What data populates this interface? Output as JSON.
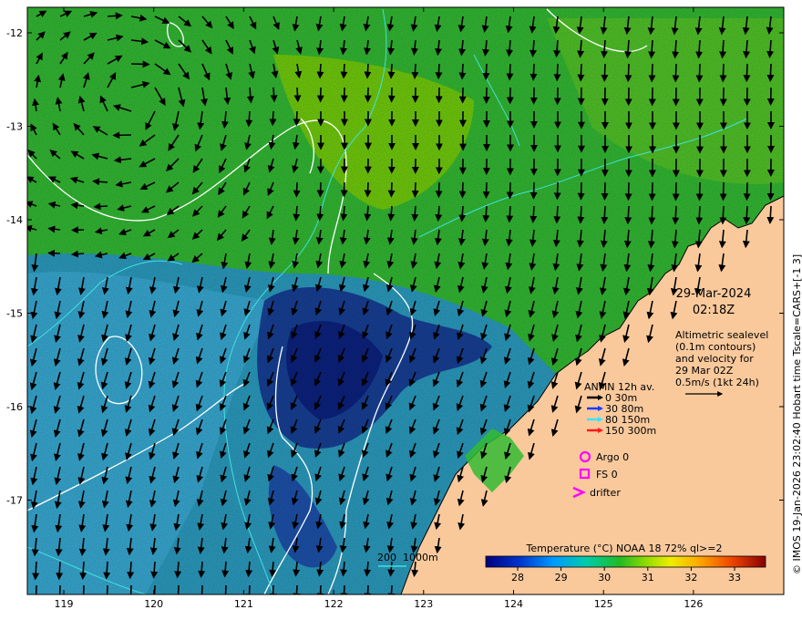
{
  "map": {
    "date": "29-Mar-2024",
    "time": "02:18Z",
    "side_credit": "© IMOS 19-Jan-2026 23:02:40 Hobart time Tscale=CARS+[-1 3]",
    "sealevel_note": [
      "Altimetric sealevel",
      "(0.1m contours)",
      "and velocity for",
      "29 Mar 02Z",
      "0.5m/s (1kt 24h)"
    ],
    "lon_ticks": [
      "119",
      "120",
      "121",
      "122",
      "123",
      "124",
      "125",
      "126"
    ],
    "lat_ticks": [
      "-12",
      "-13",
      "-14",
      "-15",
      "-16",
      "-17"
    ],
    "anmn": {
      "title": "ANMN 12h av.",
      "items": [
        {
          "label": "0 30m",
          "color": "#000000"
        },
        {
          "label": "30 80m",
          "color": "#1a3cff"
        },
        {
          "label": "80 150m",
          "color": "#40e0ff"
        },
        {
          "label": "150 300m",
          "color": "#ff1a1a"
        }
      ]
    },
    "markers": {
      "argo": "Argo 0",
      "fs": "FS 0",
      "drifter": "drifter",
      "color": "#ff00ff"
    },
    "depth_legend": {
      "label1": "200",
      "label2": "1000m"
    },
    "colorbar": {
      "title": "Temperature (°C) NOAA 18 72% ql>=2",
      "ticks": [
        "28",
        "29",
        "30",
        "31",
        "32",
        "33"
      ]
    },
    "colors": {
      "land": "#f9c99c",
      "cold": "#0a1a8a",
      "warm": "#22bb33",
      "contour": "#ffffff",
      "isobath": "#40e0e0"
    }
  }
}
